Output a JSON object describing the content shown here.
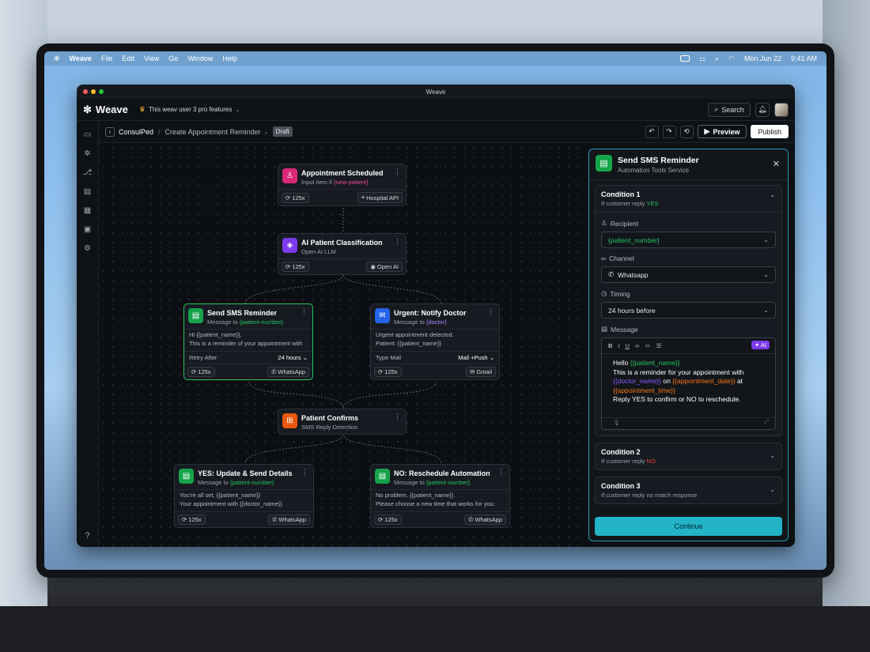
{
  "menubar": {
    "app": "Weave",
    "items": [
      "File",
      "Edit",
      "View",
      "Go",
      "Window",
      "Help"
    ],
    "date": "Mon Jun 22",
    "time": "9:41 AM"
  },
  "window": {
    "title": "Weave"
  },
  "topbar": {
    "logo": "Weave",
    "pro_features": "This weav user 3 pro features",
    "search_label": "Search"
  },
  "breadcrumb": {
    "project": "ConsulPed",
    "page": "Create Appointment Reminder",
    "status": "Draft",
    "preview_label": "Preview",
    "publish_label": "Publish"
  },
  "nodes": {
    "appointment": {
      "title": "Appointment Scheduled",
      "sub_prefix": "Input item if ",
      "sub_var": "{new-patient}",
      "count": "125x",
      "service": "Hospital API"
    },
    "classification": {
      "title": "AI Patient Classification",
      "sub": "Open AI LLM",
      "count": "125x",
      "service": "Open AI"
    },
    "sms": {
      "title": "Send SMS Reminder",
      "sub_prefix": "Message to ",
      "sub_var": "{patient-number}",
      "body1": "Hi {{patient_name}},",
      "body2": "This is a reminder of your appointment with",
      "row_label": "Retry After",
      "row_value": "24 hours",
      "count": "125x",
      "service": "WhatsApp"
    },
    "doctor": {
      "title": "Urgent: Notify Doctor",
      "sub_prefix": "Message to ",
      "sub_var": "{doctor}",
      "body1": "Urgent appointment detected.",
      "body2": "Patient: {{patient_name}}",
      "row_label": "Type Mail",
      "row_value": "Mail +Push",
      "count": "125x",
      "service": "Gmail"
    },
    "confirms": {
      "title": "Patient Confirms",
      "sub": "SMS Reply Detection"
    },
    "yes": {
      "title": "YES: Update & Send Details",
      "sub_prefix": "Message to ",
      "sub_var": "{patient-number}",
      "body1": "You're all set, {{patient_name}}",
      "body2": "Your appointment with {{doctor_name}}",
      "count": "125x",
      "service": "WhatsApp"
    },
    "no": {
      "title": "NO: Reschedule Automation",
      "sub_prefix": "Message to ",
      "sub_var": "{patient-number}",
      "body1": "No problem, {{patient_name}}.",
      "body2": "Please choose a new time that works for you:",
      "count": "125x",
      "service": "WhatsApp"
    }
  },
  "panel": {
    "title": "Send SMS Reminder",
    "subtitle": "Automation Tools Service",
    "cond1": {
      "title": "Condition 1",
      "sub_prefix": "If customer reply ",
      "sub_value": "YES",
      "recipient_label": "Recipient",
      "recipient_value": "{patient_number}",
      "channel_label": "Channel",
      "channel_value": "Whatsapp",
      "timing_label": "Timing",
      "timing_value": "24 hours before",
      "message_label": "Message",
      "ai_label": "AI",
      "msg": {
        "hello": "Hello ",
        "patient_name": "{{patient_name}}",
        "line2": "This is a reminder for your appointment with",
        "doctor_name": "{{doctor_name}}",
        "on": " on ",
        "appointment_date": "{{appointment_date}}",
        "at": " at",
        "appointment_time": "{{appointment_time}}",
        "line4": "Reply YES to confirm or NO to reschedule."
      }
    },
    "cond2": {
      "title": "Condition 2",
      "sub_prefix": "If customer reply ",
      "sub_value": "NO"
    },
    "cond3": {
      "title": "Condition 3",
      "sub": "If customer reply no match response"
    },
    "continue_label": "Continue"
  },
  "colors": {
    "accent": "#22b3c7",
    "selected_border": "#22c55e",
    "yes": "#22c55e",
    "no": "#ef4444"
  }
}
